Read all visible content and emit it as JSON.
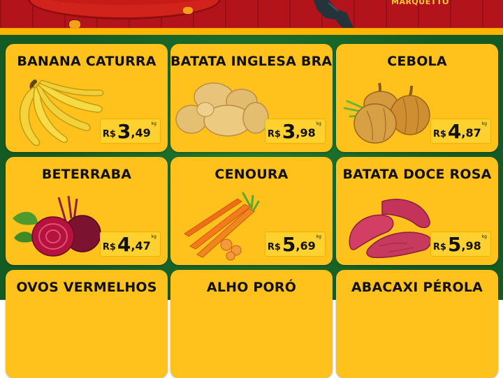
{
  "header": {
    "brand_text": "MARQUETTO",
    "colors": {
      "banner": "#b3131a",
      "stripe": "#ffb400",
      "background": "#145a23",
      "card": "#ffc21c"
    }
  },
  "products": [
    {
      "name": "BANANA CATURRA",
      "currency": "R$",
      "price_int": "3",
      "price_dec": ",49",
      "unit": "kg",
      "image": "bananas-image"
    },
    {
      "name": "BATATA INGLESA BRANCA",
      "currency": "R$",
      "price_int": "3",
      "price_dec": ",98",
      "unit": "kg",
      "image": "potatoes-image"
    },
    {
      "name": "CEBOLA",
      "currency": "R$",
      "price_int": "4",
      "price_dec": ",87",
      "unit": "kg",
      "image": "onions-image"
    },
    {
      "name": "BETERRABA",
      "currency": "R$",
      "price_int": "4",
      "price_dec": ",47",
      "unit": "kg",
      "image": "beets-image"
    },
    {
      "name": "CENOURA",
      "currency": "R$",
      "price_int": "5",
      "price_dec": ",69",
      "unit": "kg",
      "image": "carrots-image"
    },
    {
      "name": "BATATA DOCE ROSA",
      "currency": "R$",
      "price_int": "5",
      "price_dec": ",98",
      "unit": "kg",
      "image": "sweet-potatoes-image"
    },
    {
      "name": "OVOS VERMELHOS"
    },
    {
      "name": "ALHO PORÓ"
    },
    {
      "name": "ABACAXI PÉROLA"
    }
  ]
}
